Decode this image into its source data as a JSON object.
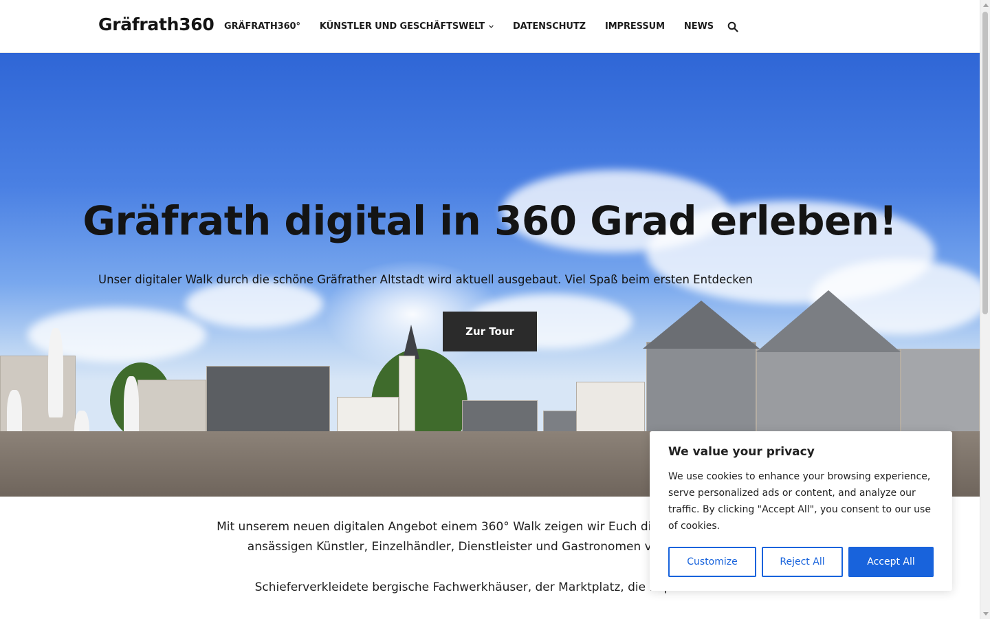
{
  "site": {
    "brand": "Gräfrath360"
  },
  "nav": {
    "items": [
      {
        "label": "GRÄFRATH360°"
      },
      {
        "label": "KÜNSTLER UND GESCHÄFTSWELT"
      },
      {
        "label": "DATENSCHUTZ"
      },
      {
        "label": "IMPRESSUM"
      },
      {
        "label": "NEWS"
      }
    ],
    "search_icon": "search-icon",
    "dropdown_icon": "chevron-down-icon"
  },
  "hero": {
    "title": "Gräfrath digital in 360 Grad erleben!",
    "subtitle": "Unser digitaler Walk durch die schöne Gräfrather Altstadt wird aktuell ausgebaut. Viel Spaß beim ersten Entdecken",
    "button_label": "Zur Tour"
  },
  "intro": {
    "paragraph1_line1": "Mit unserem neuen digitalen Angebot einem 360° Walk zeigen wir Euch die Stärken des Solin",
    "paragraph1_line2": "ansässigen Künstler, Einzelhändler, Dienstleister und Gastronomen vor. Dazu Kultu",
    "paragraph2": "Schieferverkleidete bergische Fachwerkhäuser, der Marktplatz, die imposante Kl"
  },
  "cookie": {
    "title": "We value your privacy",
    "text": "We use cookies to enhance your browsing experience, serve personalized ads or content, and analyze our traffic. By clicking \"Accept All\", you consent to our use of cookies.",
    "customize_label": "Customize",
    "reject_label": "Reject All",
    "accept_label": "Accept All"
  },
  "colors": {
    "accent": "#1863dc",
    "button_dark": "#2b2b2b",
    "sky": "#2f66d6"
  }
}
